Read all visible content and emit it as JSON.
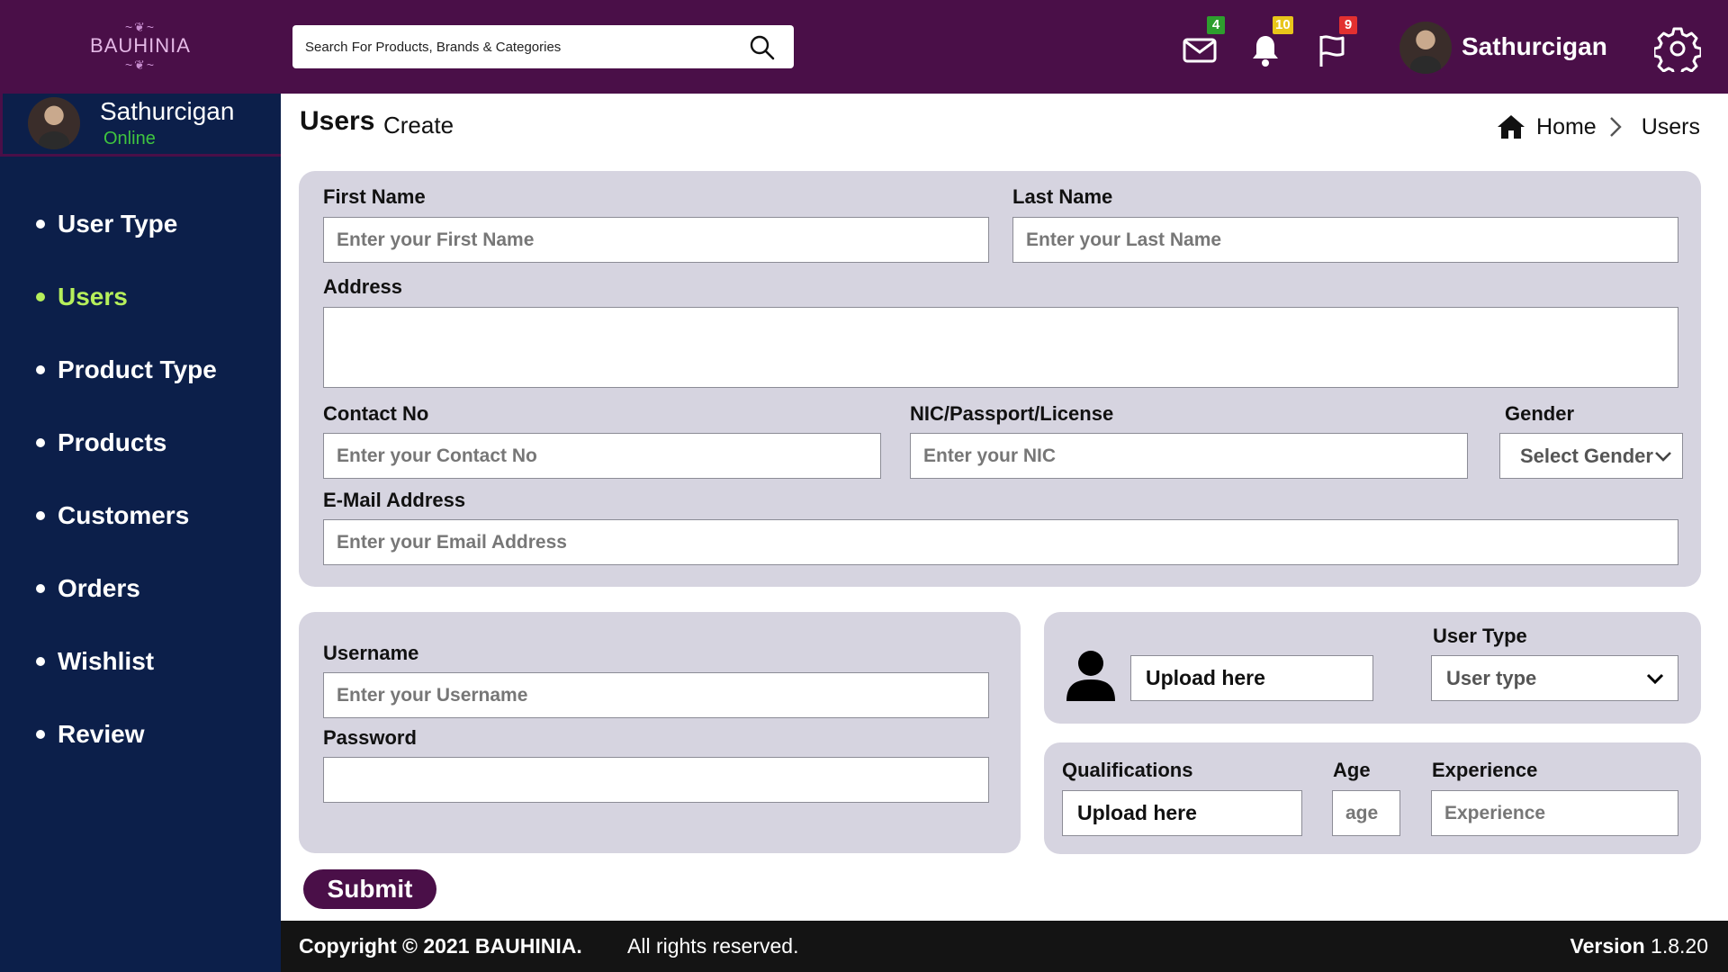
{
  "header": {
    "logo_text": "BAUHINIA",
    "search_placeholder": "Search For Products, Brands & Categories",
    "badges": {
      "mail": "4",
      "notifications": "10",
      "flags": "9"
    },
    "user_name": "Sathurcigan"
  },
  "sidebar": {
    "user_name": "Sathurcigan",
    "user_status": "Online",
    "items": [
      {
        "label": "User Type"
      },
      {
        "label": "Users"
      },
      {
        "label": "Product Type"
      },
      {
        "label": "Products"
      },
      {
        "label": "Customers"
      },
      {
        "label": "Orders"
      },
      {
        "label": "Wishlist"
      },
      {
        "label": "Review"
      }
    ],
    "active_item": "Users"
  },
  "page": {
    "title": "Users",
    "subtitle": "Create",
    "breadcrumb": {
      "home": "Home",
      "current": "Users"
    }
  },
  "form": {
    "first_name": {
      "label": "First Name",
      "placeholder": "Enter your First Name"
    },
    "last_name": {
      "label": "Last Name",
      "placeholder": "Enter your Last Name"
    },
    "address": {
      "label": "Address",
      "placeholder": ""
    },
    "contact": {
      "label": "Contact No",
      "placeholder": "Enter your Contact No"
    },
    "nic": {
      "label": "NIC/Passport/License",
      "placeholder": "Enter your NIC"
    },
    "gender": {
      "label": "Gender",
      "selected": "Select Gender"
    },
    "email": {
      "label": "E-Mail Address",
      "placeholder": "Enter your Email Address"
    },
    "username": {
      "label": "Username",
      "placeholder": "Enter your Username"
    },
    "password": {
      "label": "Password",
      "placeholder": ""
    },
    "photo_upload": {
      "label": "Upload here"
    },
    "user_type": {
      "label": "User Type",
      "selected": "User type"
    },
    "qualifications": {
      "label": "Qualifications",
      "upload_label": "Upload here"
    },
    "age": {
      "label": "Age",
      "placeholder": "age"
    },
    "experience": {
      "label": "Experience",
      "placeholder": "Experience"
    },
    "submit_label": "Submit"
  },
  "footer": {
    "copyright": "Copyright © 2021 BAUHINIA.",
    "rights": "All rights reserved.",
    "version_label": "Version",
    "version_value": "1.8.20"
  },
  "colors": {
    "header_bg": "#4a0f48",
    "sidebar_bg": "#0c1f4a",
    "active_nav": "#b6ef5b",
    "panel_bg": "#d6d4e0",
    "footer_bg": "#141414",
    "online_status": "#3fc43f"
  }
}
